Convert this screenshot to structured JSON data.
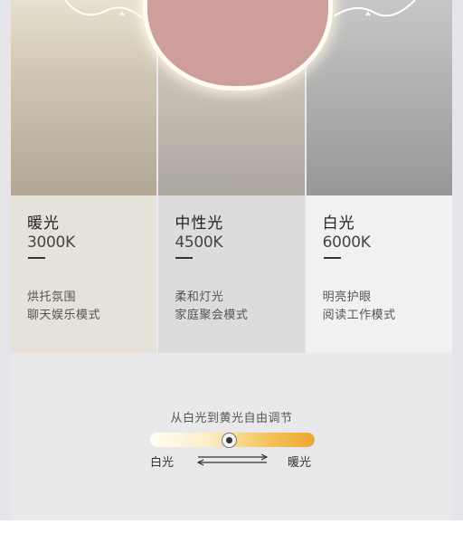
{
  "panels": [
    {
      "name": "暖光",
      "temp": "3000K",
      "line1": "烘托氛围",
      "line2": "聊天娱乐模式"
    },
    {
      "name": "中性光",
      "temp": "4500K",
      "line1": "柔和灯光",
      "line2": "家庭聚会模式"
    },
    {
      "name": "白光",
      "temp": "6000K",
      "line1": "明亮护眼",
      "line2": "阅读工作模式"
    }
  ],
  "slider": {
    "title": "从白光到黄光自由调节",
    "left_label": "白光",
    "right_label": "暖光",
    "position": 0.48
  },
  "colors": {
    "track_start": "#fffdf5",
    "track_end": "#efa531",
    "heart": "#ce9e9b"
  }
}
